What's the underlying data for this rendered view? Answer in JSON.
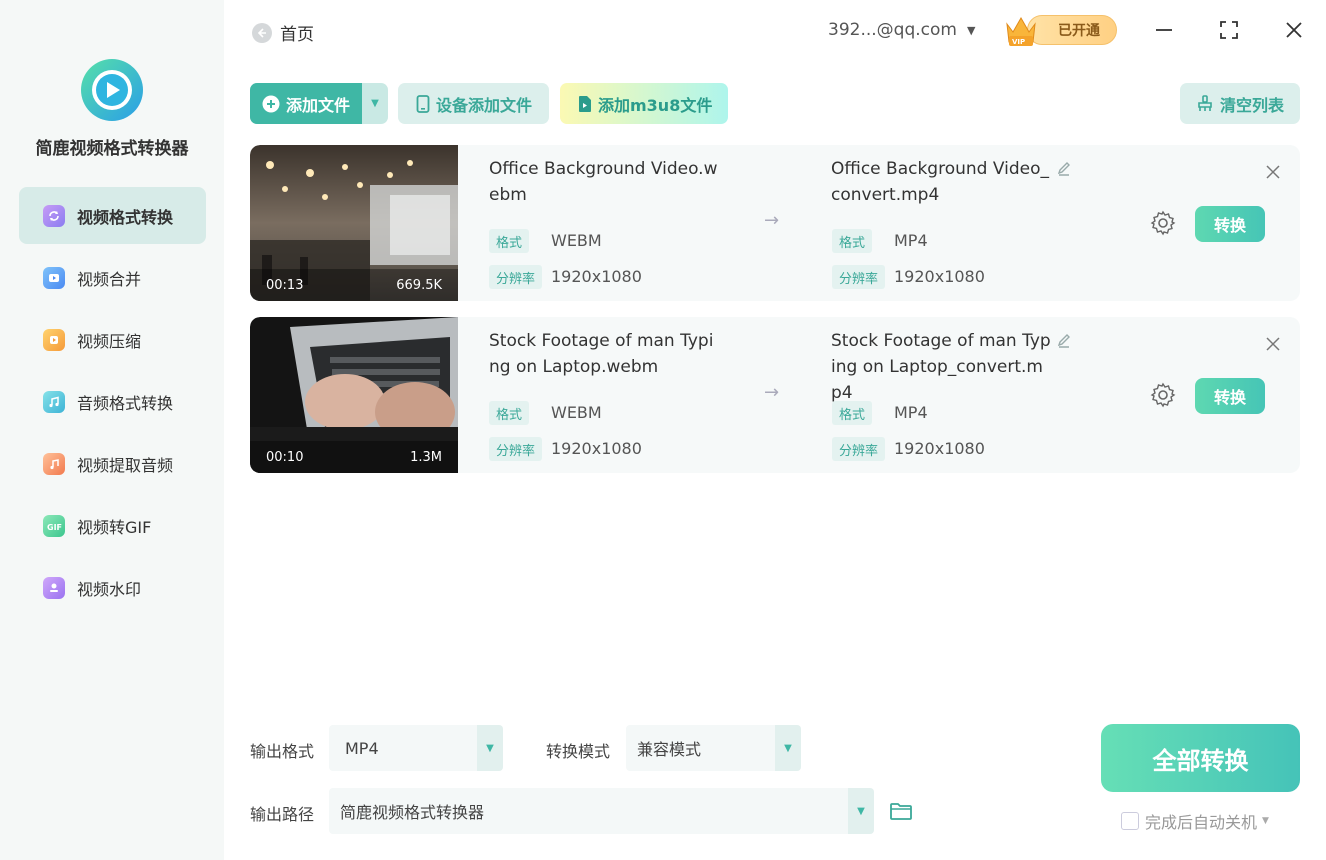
{
  "app": {
    "name": "简鹿视频格式转换器"
  },
  "sidebar": {
    "items": [
      {
        "label": "视频格式转换",
        "icon": "video-convert-icon",
        "active": true,
        "color": "#b58cf0"
      },
      {
        "label": "视频合并",
        "icon": "video-merge-icon",
        "active": false,
        "color": "#6aa7f5"
      },
      {
        "label": "视频压缩",
        "icon": "video-compress-icon",
        "active": false,
        "color": "#f5b74a"
      },
      {
        "label": "音频格式转换",
        "icon": "audio-convert-icon",
        "active": false,
        "color": "#5ec8d8"
      },
      {
        "label": "视频提取音频",
        "icon": "extract-audio-icon",
        "active": false,
        "color": "#f59a6a"
      },
      {
        "label": "视频转GIF",
        "icon": "gif-icon",
        "active": false,
        "color": "#5fd0a0"
      },
      {
        "label": "视频水印",
        "icon": "watermark-icon",
        "active": false,
        "color": "#b88cf2"
      }
    ]
  },
  "header": {
    "back_label": "首页",
    "account": "392...@qq.com",
    "vip_label": "已开通",
    "vip_badge": "VIP"
  },
  "toolbar": {
    "add_file": "添加文件",
    "device_add": "设备添加文件",
    "add_m3u8": "添加m3u8文件",
    "clear_list": "清空列表"
  },
  "labels": {
    "format": "格式",
    "resolution": "分辨率",
    "convert": "转换"
  },
  "files": [
    {
      "source_name": "Office Background Video.webm",
      "source_format": "WEBM",
      "source_resolution": "1920x1080",
      "target_name": "Office Background Video_convert.mp4",
      "target_format": "MP4",
      "target_resolution": "1920x1080",
      "duration": "00:13",
      "size": "669.5K"
    },
    {
      "source_name": "Stock Footage of man Typing on Laptop.webm",
      "source_format": "WEBM",
      "source_resolution": "1920x1080",
      "target_name": "Stock Footage of man Typing on Laptop_convert.mp4",
      "target_format": "MP4",
      "target_resolution": "1920x1080",
      "duration": "00:10",
      "size": "1.3M"
    }
  ],
  "settings": {
    "output_format_label": "输出格式",
    "output_format_value": "MP4",
    "mode_label": "转换模式",
    "mode_value": "兼容模式",
    "path_label": "输出路径",
    "path_value": "简鹿视频格式转换器"
  },
  "actions": {
    "convert_all": "全部转换",
    "auto_shutdown": "完成后自动关机"
  },
  "colors": {
    "accent": "#3fb7a5",
    "sidebar_active": "#d7ebe8"
  }
}
